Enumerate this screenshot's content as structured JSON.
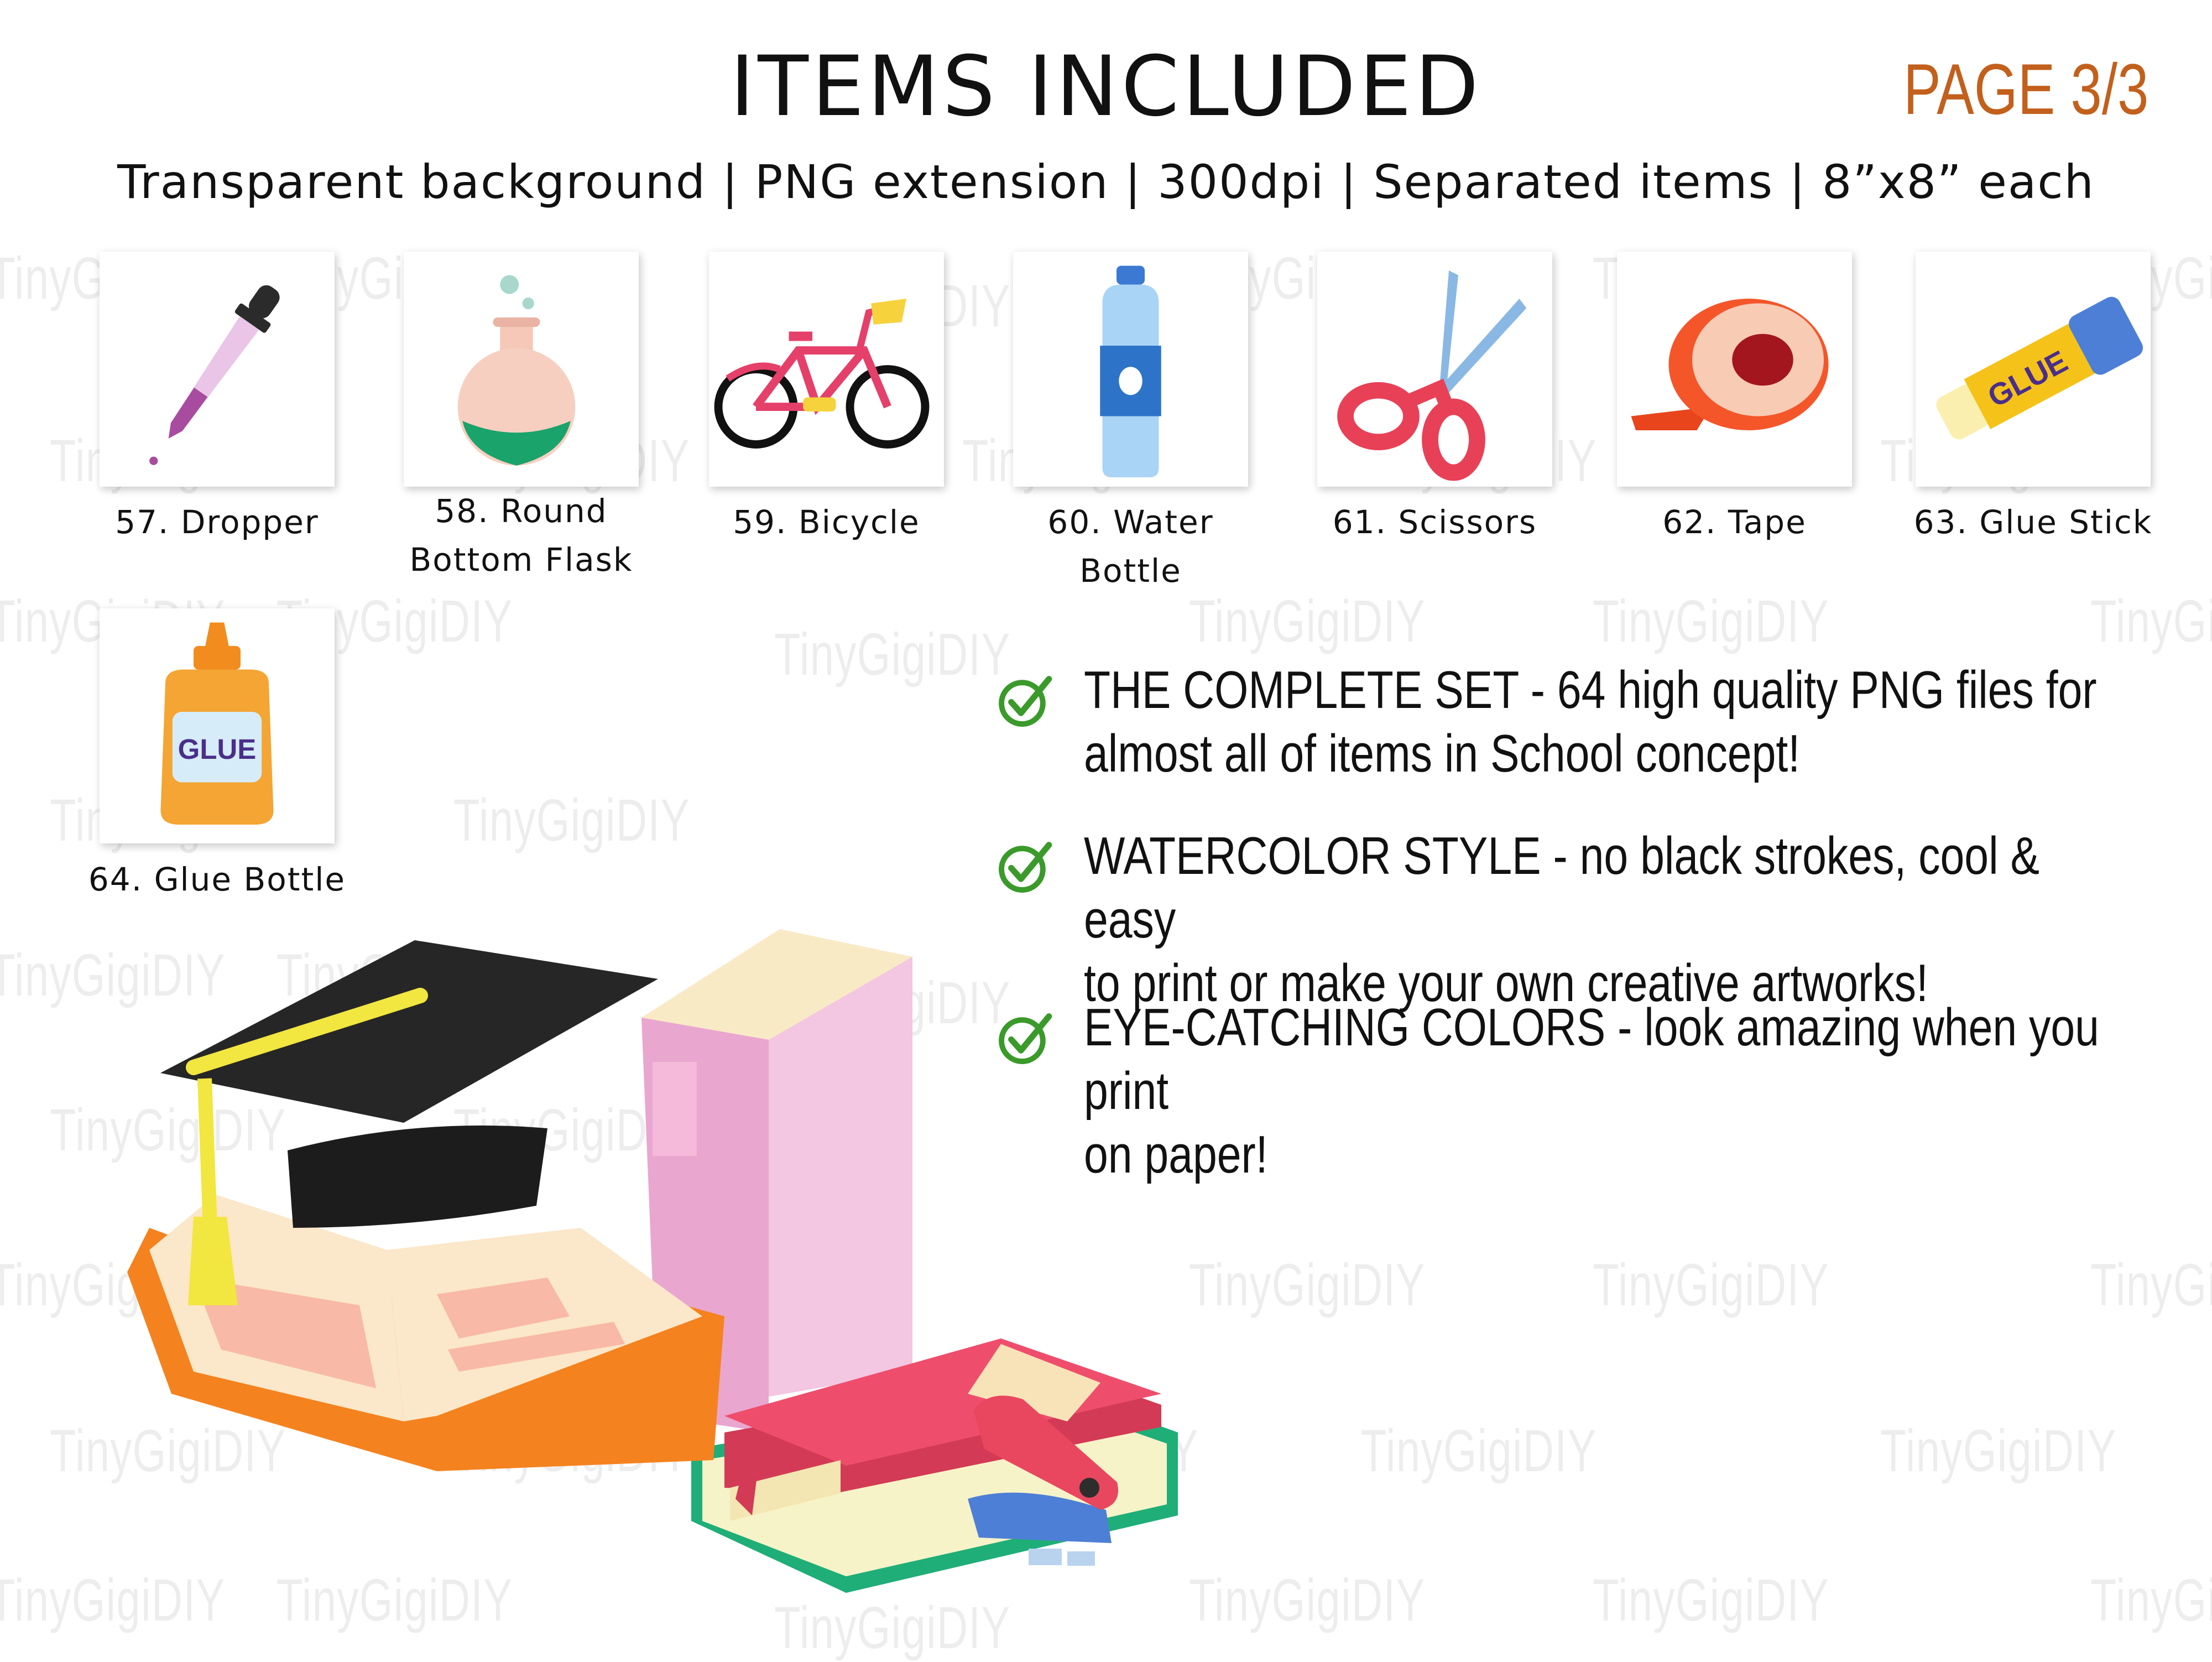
{
  "header": {
    "title": "ITEMS INCLUDED",
    "page": "PAGE 3/3",
    "specs": "Transparent background | PNG extension | 300dpi | Separated items | 8”x8” each"
  },
  "watermark": "TinyGigiDIY",
  "items": [
    {
      "label_line1": "57. Dropper",
      "label_line2": "",
      "icon": "dropper-icon"
    },
    {
      "label_line1": "58. Round",
      "label_line2": "Bottom Flask",
      "icon": "round-bottom-flask-icon"
    },
    {
      "label_line1": "59. Bicycle",
      "label_line2": "",
      "icon": "bicycle-icon"
    },
    {
      "label_line1": "60. Water",
      "label_line2": "Bottle",
      "icon": "water-bottle-icon"
    },
    {
      "label_line1": "61. Scissors",
      "label_line2": "",
      "icon": "scissors-icon"
    },
    {
      "label_line1": "62. Tape",
      "label_line2": "",
      "icon": "tape-icon"
    },
    {
      "label_line1": "63. Glue Stick",
      "label_line2": "",
      "icon": "glue-stick-icon"
    },
    {
      "label_line1": "64. Glue Bottle",
      "label_line2": "",
      "icon": "glue-bottle-icon"
    }
  ],
  "icon_text": {
    "glue": "GLUE"
  },
  "features": [
    {
      "line1": "THE COMPLETE SET - 64 high quality PNG files for",
      "line2": "almost all of items in School concept!"
    },
    {
      "line1": "WATERCOLOR STYLE - no black strokes, cool & easy",
      "line2": "to print or make your own creative artworks!"
    },
    {
      "line1": "EYE-CATCHING COLORS - look amazing when you print",
      "line2": "on paper!"
    }
  ],
  "colors": {
    "page_accent": "#c2601c",
    "check": "#3a9a2a"
  }
}
